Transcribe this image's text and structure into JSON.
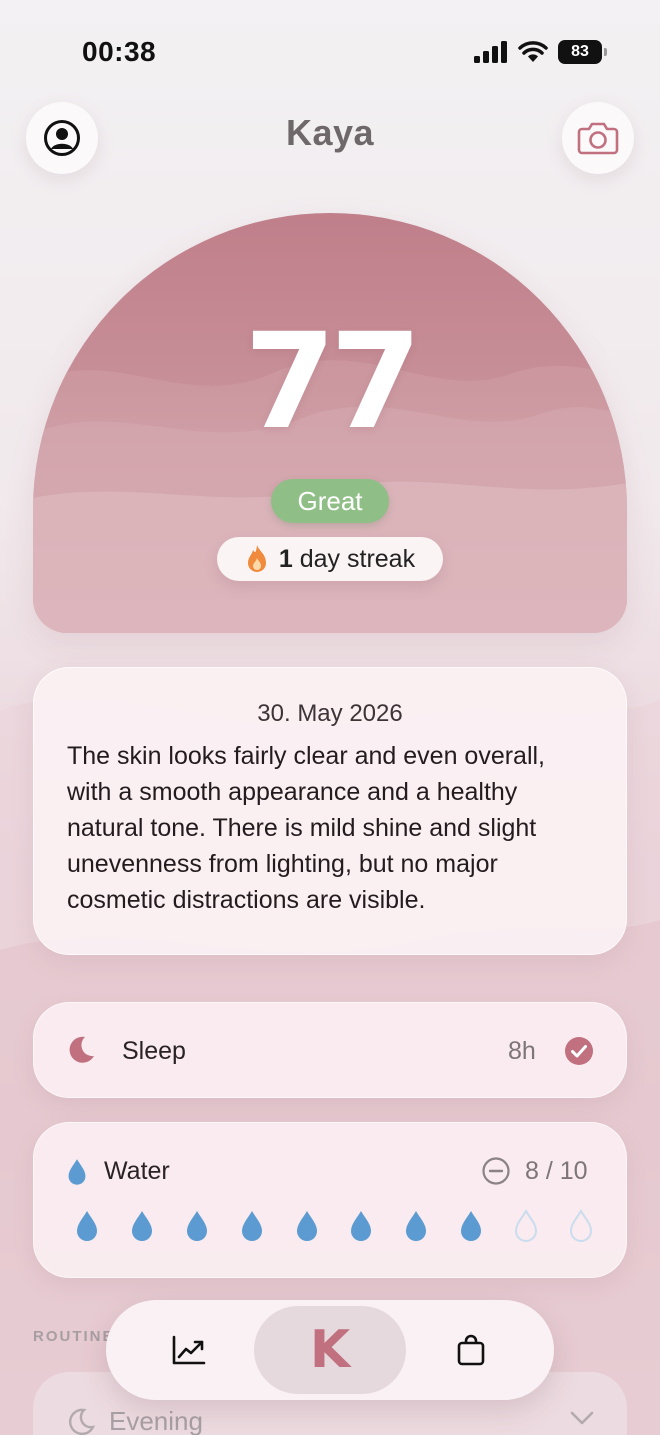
{
  "status_bar": {
    "time": "00:38",
    "battery": "83"
  },
  "header": {
    "title": "Kaya"
  },
  "score": {
    "value": "77",
    "rating": "Great",
    "streak_count": "1",
    "streak_label": "day streak"
  },
  "summary": {
    "date": "30. May 2026",
    "text": "The skin looks fairly clear and even overall, with a smooth appearance and a healthy natural tone. There is mild shine and slight unevenness from lighting, but no major cosmetic distractions are visible."
  },
  "sleep": {
    "label": "Sleep",
    "value": "8h",
    "completed": true
  },
  "water": {
    "label": "Water",
    "value": "8 / 10",
    "filled": 8,
    "total": 10
  },
  "routine": {
    "section_label": "ROUTINE",
    "evening_label": "Evening"
  },
  "colors": {
    "accent": "#c0707e",
    "score_bg": "#c07f8a",
    "badge_green": "#8fbf86",
    "water_blue": "#5b9bd1"
  },
  "icons": {
    "profile": "profile-icon",
    "camera": "camera-icon",
    "streak": "flame-icon",
    "sleep": "moon-icon",
    "sleep_done": "check-circle-icon",
    "water": "water-drop-icon",
    "water_minus": "minus-circle-icon",
    "stats": "chart-icon",
    "shop": "shopping-bag-icon"
  },
  "nav": {
    "home_label": "K"
  }
}
